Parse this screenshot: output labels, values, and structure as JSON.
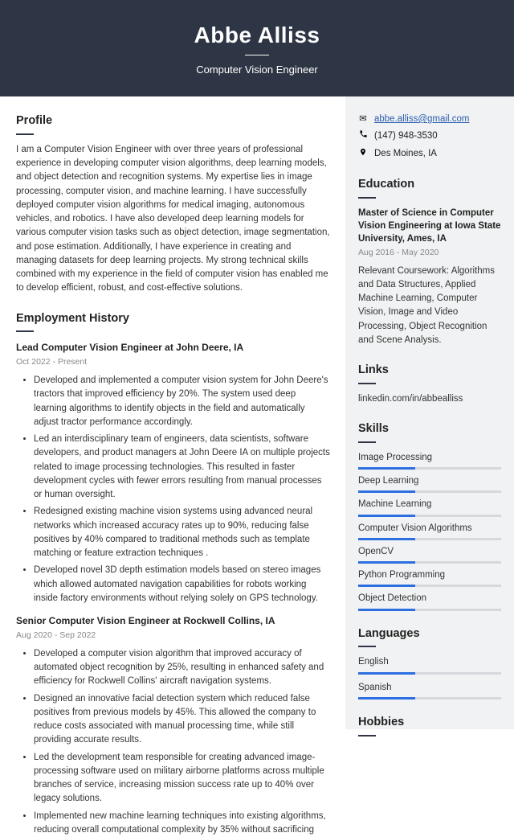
{
  "header": {
    "name": "Abbe Alliss",
    "subtitle": "Computer Vision Engineer"
  },
  "contact": {
    "email": "abbe.alliss@gmail.com",
    "phone": "(147) 948-3530",
    "location": "Des Moines, IA"
  },
  "sections": {
    "profile_title": "Profile",
    "employment_title": "Employment History",
    "education_title": "Education",
    "links_title": "Links",
    "skills_title": "Skills",
    "languages_title": "Languages",
    "hobbies_title": "Hobbies"
  },
  "profile": "I am a Computer Vision Engineer with over three years of professional experience in developing computer vision algorithms, deep learning models, and object detection and recognition systems. My expertise lies in image processing, computer vision, and machine learning. I have successfully deployed computer vision algorithms for medical imaging, autonomous vehicles, and robotics. I have also developed deep learning models for various computer vision tasks such as object detection, image segmentation, and pose estimation. Additionally, I have experience in creating and managing datasets for deep learning projects. My strong technical skills combined with my experience in the field of computer vision has enabled me to develop efficient, robust, and cost-effective solutions.",
  "jobs": [
    {
      "title": "Lead Computer Vision Engineer at John Deere, IA",
      "dates": "Oct 2022 - Present",
      "bullets": [
        "Developed and implemented a computer vision system for John Deere's tractors that improved efficiency by 20%. The system used deep learning algorithms to identify objects in the field and automatically adjust tractor performance accordingly.",
        "Led an interdisciplinary team of engineers, data scientists, software developers, and product managers at John Deere IA on multiple projects related to image processing technologies.  This resulted in faster development cycles with fewer errors resulting from manual processes or human oversight.",
        "Redesigned existing machine vision systems using advanced neural networks which increased accuracy rates up to 90%, reducing false positives by 40% compared to traditional methods such as template matching or feature extraction techniques .",
        "Developed novel 3D depth estimation models based on stereo images which allowed automated navigation capabilities for robots working inside factory environments without relying solely on GPS technology."
      ]
    },
    {
      "title": "Senior Computer Vision Engineer at Rockwell Collins, IA",
      "dates": "Aug 2020 - Sep 2022",
      "bullets": [
        "Developed a computer vision algorithm that improved accuracy of automated object recognition by 25%, resulting in enhanced safety and efficiency for Rockwell Collins' aircraft navigation systems.",
        "Designed an innovative facial detection system which reduced false positives from previous models by 45%. This allowed the company to reduce costs associated with manual processing time, while still providing accurate results.",
        "Led the development team responsible for creating advanced image-processing software used on military airborne platforms across multiple branches of service, increasing mission success rate up to 40% over legacy solutions.",
        "Implemented new machine learning techniques into existing algorithms, reducing overall computational complexity by 35% without sacrificing"
      ]
    }
  ],
  "education": {
    "degree": "Master of Science in Computer Vision Engineering at Iowa State University, Ames, IA",
    "dates": "Aug 2016 - May 2020",
    "desc": "Relevant Coursework: Algorithms and Data Structures, Applied Machine Learning, Computer Vision, Image and Video Processing, Object Recognition and Scene Analysis."
  },
  "links": {
    "linkedin": "linkedin.com/in/abbealliss"
  },
  "skills": [
    {
      "name": "Image Processing",
      "level": 40
    },
    {
      "name": "Deep Learning",
      "level": 40
    },
    {
      "name": "Machine Learning",
      "level": 40
    },
    {
      "name": "Computer Vision Algorithms",
      "level": 40
    },
    {
      "name": "OpenCV",
      "level": 40
    },
    {
      "name": "Python Programming",
      "level": 40
    },
    {
      "name": "Object Detection",
      "level": 40
    }
  ],
  "languages": [
    {
      "name": "English",
      "level": 40
    },
    {
      "name": "Spanish",
      "level": 40
    }
  ]
}
